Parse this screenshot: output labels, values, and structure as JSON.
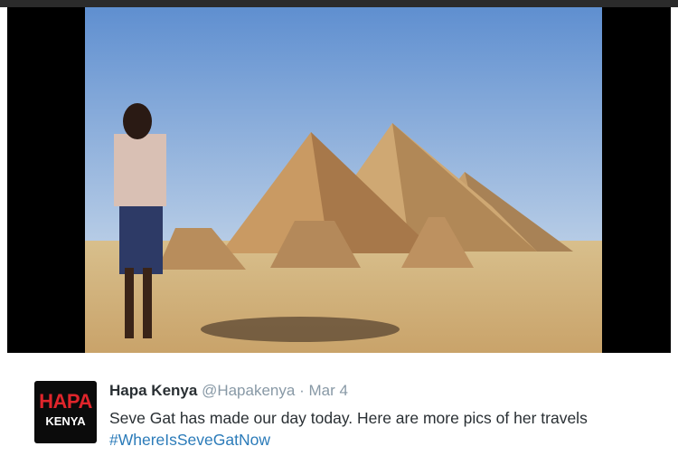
{
  "tweet": {
    "author_name": "Hapa Kenya",
    "handle": "@Hapakenya",
    "separator": "·",
    "date": "Mar 4",
    "text": "Seve Gat has made our day today. Here are more pics of her travels",
    "hashtag": "#WhereIsSeveGatNow"
  },
  "avatar": {
    "line1": "HAPA",
    "line2": "KENYA"
  },
  "media": {
    "icon": "photo-image"
  },
  "colors": {
    "name": "#292f33",
    "meta": "#8899a6",
    "hashtag": "#2b7bb9",
    "avatar_red": "#e0252b"
  }
}
